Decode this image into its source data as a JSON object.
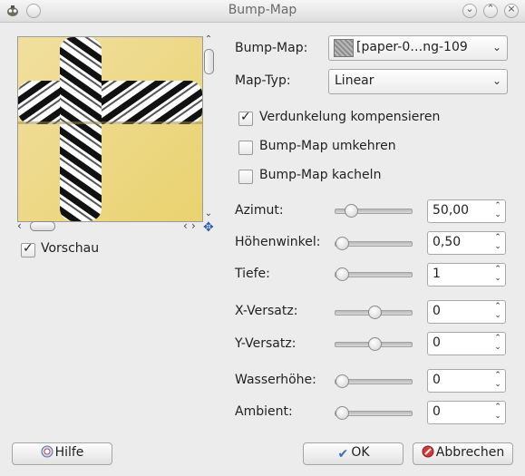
{
  "window": {
    "title": "Bump-Map"
  },
  "preview": {
    "toggle_label": "Vorschau",
    "toggle_checked": true
  },
  "fields": {
    "bumpmap": {
      "label": "Bump-Map:",
      "value": "[paper-0…ng-109"
    },
    "maptyp": {
      "label": "Map-Typ:",
      "value": "Linear"
    }
  },
  "options": [
    {
      "label": "Verdunkelung kompensieren",
      "checked": true
    },
    {
      "label": "Bump-Map umkehren",
      "checked": false
    },
    {
      "label": "Bump-Map kacheln",
      "checked": false
    }
  ],
  "sliders": [
    {
      "label": "Azimut:",
      "value": "50,00",
      "fraction": 0.14
    },
    {
      "label": "Höhenwinkel:",
      "value": "0,50",
      "fraction": 0.0
    },
    {
      "label": "Tiefe:",
      "value": "1",
      "fraction": 0.0
    },
    {
      "label": "X-Versatz:",
      "value": "0",
      "fraction": 0.5
    },
    {
      "label": "Y-Versatz:",
      "value": "0",
      "fraction": 0.5
    },
    {
      "label": "Wasserhöhe:",
      "value": "0",
      "fraction": 0.0
    },
    {
      "label": "Ambient:",
      "value": "0",
      "fraction": 0.0
    }
  ],
  "buttons": {
    "help": "Hilfe",
    "ok": "OK",
    "cancel": "Abbrechen"
  },
  "icons": {
    "app": "gimp-icon",
    "close": "close-icon",
    "minimize": "minimize-icon",
    "restore": "restore-icon",
    "maximize": "maximize-icon",
    "navigate": "move-icon",
    "help": "help-icon",
    "ok": "checkmark-icon",
    "cancel": "cancel-icon"
  }
}
